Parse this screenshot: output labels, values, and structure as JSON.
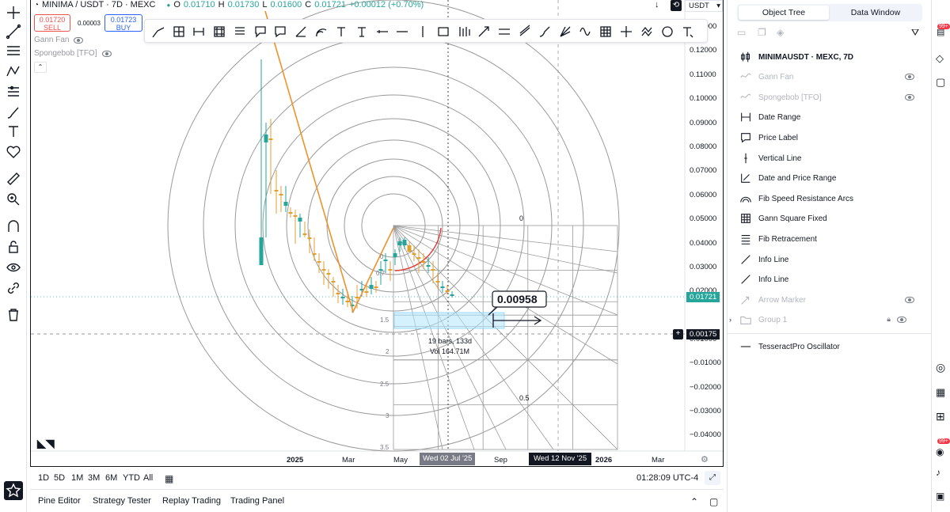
{
  "header": {
    "symbol": "MINIMA / USDT · 7D · MEXC",
    "open_label": "O",
    "open": "0.01710",
    "high_label": "H",
    "high": "0.01730",
    "low_label": "L",
    "low": "0.01600",
    "close_label": "C",
    "close": "0.01721",
    "change": "+0.00012 (+0.70%)",
    "sell_price": "0.01720",
    "sell_label": "SELL",
    "spread": "0.00003",
    "buy_price": "0.01723",
    "buy_label": "BUY",
    "currency": "USDT"
  },
  "studies": [
    {
      "name": "Gann Fan"
    },
    {
      "name": "Spongebob [TFO]"
    }
  ],
  "price_axis": {
    "ticks": [
      "0.13000",
      "0.12000",
      "0.11000",
      "0.10000",
      "0.09000",
      "0.08000",
      "0.07000",
      "0.06000",
      "0.05000",
      "0.04000",
      "0.03000",
      "0.02000",
      "0.01000",
      "−0.01000",
      "−0.02000",
      "−0.03000",
      "−0.04000"
    ],
    "last_price": "0.01721",
    "crosshair_price": "0.00175"
  },
  "time_axis": {
    "ticks": [
      "2025",
      "Mar",
      "May",
      "Sep",
      "2026",
      "Mar"
    ],
    "highlight_1": "Wed 02 Jul '25",
    "highlight_2": "Wed 12 Nov '25"
  },
  "drawings": {
    "measure_value": "0.00958",
    "range_bars": "19 bars, 133d",
    "range_vol": "Vol 164.71M",
    "fib_levels": [
      "0",
      "0.5",
      "0.7",
      "1.5",
      "2",
      "2.5",
      "3",
      "3.5"
    ],
    "grid_labels": [
      "0",
      "0.5"
    ]
  },
  "range_bar": {
    "buttons": [
      "1D",
      "5D",
      "1M",
      "3M",
      "6M",
      "YTD",
      "All"
    ],
    "clock": "01:28:09 UTC-4"
  },
  "bottom_tabs": [
    "Pine Editor",
    "Strategy Tester",
    "Replay Trading",
    "Trading Panel"
  ],
  "panel": {
    "tab_object_tree": "Object Tree",
    "tab_data_window": "Data Window",
    "items": [
      {
        "label": "MINIMAUSDT · MEXC, 7D",
        "icon": "candles-icon"
      },
      {
        "label": "Gann Fan",
        "icon": "wave-icon"
      },
      {
        "label": "Spongebob [TFO]",
        "icon": "wave-icon"
      },
      {
        "label": "Date Range",
        "icon": "date-range-icon"
      },
      {
        "label": "Price Label",
        "icon": "price-label-icon"
      },
      {
        "label": "Vertical Line",
        "icon": "vertical-line-icon"
      },
      {
        "label": "Date and Price Range",
        "icon": "date-price-range-icon"
      },
      {
        "label": "Fib Speed Resistance Arcs",
        "icon": "fib-arcs-icon"
      },
      {
        "label": "Gann Square Fixed",
        "icon": "gann-square-icon"
      },
      {
        "label": "Fib Retracement",
        "icon": "fib-retracement-icon"
      },
      {
        "label": "Info Line",
        "icon": "info-line-icon"
      },
      {
        "label": "Info Line",
        "icon": "info-line-icon"
      },
      {
        "label": "Arrow Marker",
        "icon": "arrow-marker-icon"
      },
      {
        "label": "Group 1",
        "icon": "folder-icon"
      },
      {
        "label": "TesseractPro Oscillator",
        "icon": "oscillator-icon"
      }
    ]
  },
  "right_edge": {
    "badge_1": "99+",
    "badge_2": "99+"
  },
  "colors": {
    "up": "#26a69a",
    "down": "#e0a030",
    "trend": "#f0922b",
    "arc": "#9a9a9a",
    "accent": "#2962ff"
  }
}
